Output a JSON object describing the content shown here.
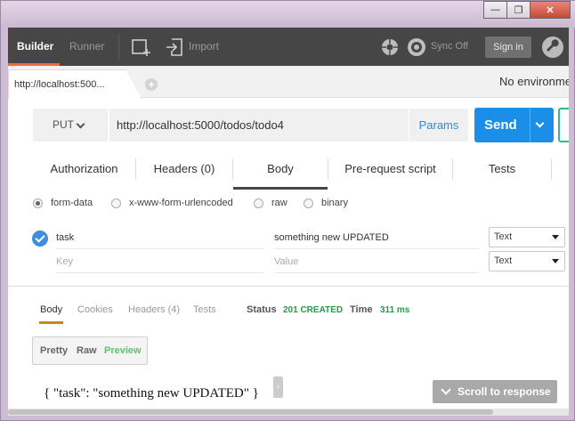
{
  "window": {
    "minimize_label": "—",
    "maximize_label": "❐",
    "close_label": "✕"
  },
  "header": {
    "tabs": [
      {
        "label": "Builder",
        "active": true
      },
      {
        "label": "Runner",
        "active": false
      }
    ],
    "new_tab_icon": "new-window-icon",
    "import_icon": "import-icon",
    "import_label": "Import",
    "sync_icon": "sync-icon",
    "sync_label": "Sync Off",
    "signin_label": "Sign in",
    "settings_icon": "wrench-icon",
    "accent": "#f26b3a"
  },
  "request_tab": {
    "label": "http://localhost:500...",
    "add_label": "+",
    "environment": "No environme"
  },
  "request": {
    "method": "PUT",
    "url": "http://localhost:5000/todos/todo4",
    "params_label": "Params",
    "send_label": "Send",
    "send_color": "#1b8ee8"
  },
  "subtabs": [
    {
      "label": "Authorization",
      "active": false
    },
    {
      "label": "Headers (0)",
      "active": false
    },
    {
      "label": "Body",
      "active": true
    },
    {
      "label": "Pre-request script",
      "active": false
    },
    {
      "label": "Tests",
      "active": false
    }
  ],
  "body_modes": [
    {
      "label": "form-data",
      "selected": true
    },
    {
      "label": "x-www-form-urlencoded",
      "selected": false
    },
    {
      "label": "raw",
      "selected": false
    },
    {
      "label": "binary",
      "selected": false
    }
  ],
  "form_rows": [
    {
      "key": "task",
      "value": "something new UPDATED",
      "type": "Text",
      "checked": true
    },
    {
      "key_placeholder": "Key",
      "value_placeholder": "Value",
      "type": "Text"
    }
  ],
  "response": {
    "tabs": [
      {
        "label": "Body",
        "active": true
      },
      {
        "label": "Cookies",
        "active": false
      },
      {
        "label": "Headers (4)",
        "active": false
      },
      {
        "label": "Tests",
        "active": false
      }
    ],
    "status_label": "Status",
    "status_value": "201 CREATED",
    "time_label": "Time",
    "time_value": "311 ms",
    "view_modes": [
      {
        "label": "Pretty",
        "active": false
      },
      {
        "label": "Raw",
        "active": false
      },
      {
        "label": "Preview",
        "active": true
      }
    ],
    "body_text": "{ \"task\": \"something new UPDATED\" }",
    "scroll_label": "Scroll to response",
    "status_color": "#279a4b"
  }
}
